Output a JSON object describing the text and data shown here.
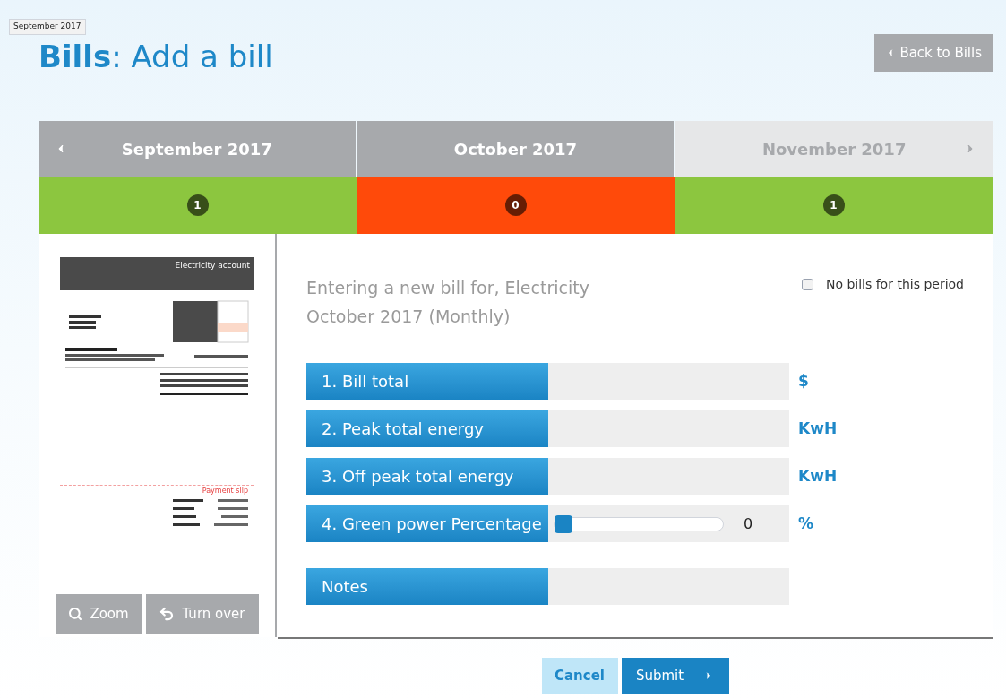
{
  "tooltip": "September 2017",
  "header": {
    "title_bold": "Bills",
    "title_rest": ": Add a bill",
    "back_button": "Back to Bills"
  },
  "months": [
    {
      "label": "September 2017",
      "disabled": false,
      "count": "1",
      "color": "#8cc63f"
    },
    {
      "label": "October 2017",
      "disabled": false,
      "count": "0",
      "color": "#ff4a0a"
    },
    {
      "label": "November 2017",
      "disabled": true,
      "count": "1",
      "color": "#8cc63f"
    }
  ],
  "document": {
    "heading": "Electricity account",
    "slip_title": "Payment slip"
  },
  "doc_buttons": [
    {
      "label": "Zoom",
      "kind": "zoom"
    },
    {
      "label": "Turn over",
      "kind": "turn"
    }
  ],
  "form": {
    "intro": [
      "Entering a new bill for, Electricity",
      "October 2017 (Monthly)"
    ],
    "no_bills": {
      "label": "No bills for this period",
      "checked": false
    },
    "fields": [
      {
        "kind": "input",
        "label": "1. Bill total",
        "unit": "$"
      },
      {
        "kind": "input",
        "label": "2. Peak total energy",
        "unit": "KwH"
      },
      {
        "kind": "input",
        "label": "3. Off peak total energy",
        "unit": "KwH"
      },
      {
        "kind": "slider",
        "label": "4. Green power Percentage",
        "level": 0,
        "reading": "0",
        "unit": "%"
      }
    ],
    "notes": {
      "label": "Notes"
    }
  },
  "actions": {
    "cancel": "Cancel",
    "submit": "Submit"
  }
}
